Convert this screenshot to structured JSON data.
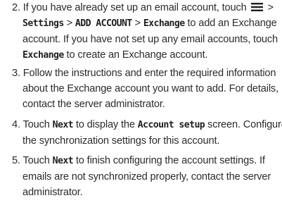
{
  "steps": [
    {
      "number": "2.",
      "lines": [
        {
          "t1": "If you have already set up an email account, touch",
          "t2": ">"
        },
        {
          "b1": "Settings",
          "s1": ">",
          "b2": "ADD ACCOUNT",
          "s2": ">",
          "b3": "Exchange",
          "t": "to add an Exchange"
        },
        {
          "t": "account. If you have not set up any email accounts, touch"
        },
        {
          "b": "Exchange",
          "t": "to create an Exchange account."
        }
      ]
    },
    {
      "number": "3.",
      "lines": [
        {
          "t": "Follow the instructions and enter the required information"
        },
        {
          "t": "about the Exchange account you want to add. For details,"
        },
        {
          "t": "contact the server administrator."
        }
      ]
    },
    {
      "number": "4.",
      "lines": [
        {
          "t1": "Touch",
          "b1": "Next",
          "t2": "to display the",
          "b2": "Account setup",
          "t3": "screen. Configure"
        },
        {
          "t": "the synchronization settings for this account."
        }
      ]
    },
    {
      "number": "5.",
      "lines": [
        {
          "t1": "Touch",
          "b1": "Next",
          "t2": "to finish configuring the account settings. If"
        },
        {
          "t": "emails are not synchronized properly, contact the server"
        },
        {
          "t": "administrator."
        }
      ]
    }
  ],
  "icons": {
    "menu": "menu-icon"
  }
}
